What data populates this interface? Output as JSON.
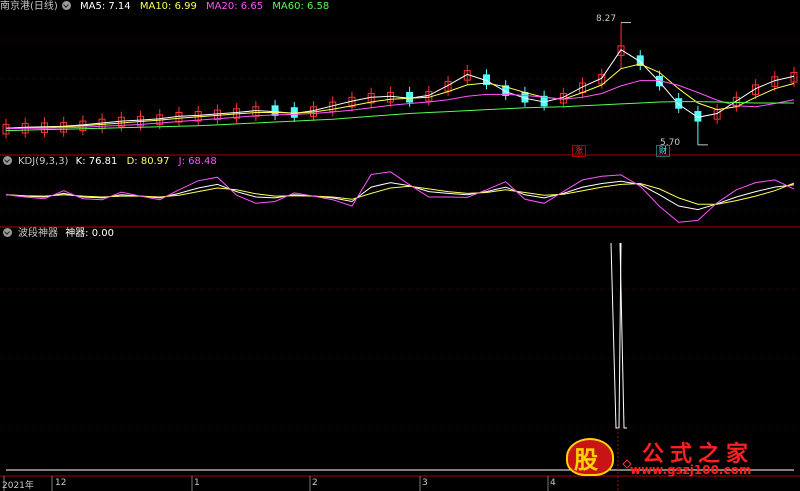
{
  "header": {
    "stock_name": "南京港(日线)",
    "ma5": "MA5: 7.14",
    "ma10": "MA10: 6.99",
    "ma20": "MA20: 6.65",
    "ma60": "MA60: 6.58"
  },
  "kdj_header": {
    "name": "KDJ(9,3,3)",
    "k": "K: 76.81",
    "d": "D: 80.97",
    "j": "J: 68.48"
  },
  "indicator_header": {
    "name": "波段神器",
    "value": "神器: 0.00"
  },
  "price_annotations": {
    "high": "8.27",
    "low": "5.70",
    "up_tag": "涨",
    "low_tag": "财"
  },
  "watermark": {
    "glyph": "股",
    "brand": "公式之家",
    "url": "www.gszj100.com"
  },
  "colors": {
    "background": "#000000",
    "up": "#ff3232",
    "down": "#54ffff",
    "ma5": "#ffffff",
    "ma10": "#ffff54",
    "ma20": "#ff54ff",
    "ma60": "#54ff54",
    "kdj_k": "#ffffff",
    "kdj_d": "#ffff54",
    "kdj_j": "#ff54ff",
    "separator": "#aa0000",
    "grid": "#3a0000"
  },
  "x_axis": {
    "labels": [
      "2021年",
      "12",
      "1",
      "2",
      "3",
      "4"
    ]
  },
  "chart_data": [
    {
      "type": "candlestick",
      "title": "南京港(日线)",
      "series": [
        {
          "name": "MA5",
          "values": [
            6.05,
            6.07,
            6.08,
            6.09,
            6.12,
            6.16,
            6.2,
            6.22,
            6.25,
            6.3,
            6.32,
            6.35,
            6.38,
            6.42,
            6.4,
            6.36,
            6.42,
            6.52,
            6.62,
            6.7,
            6.72,
            6.68,
            6.74,
            6.95,
            7.18,
            7.05,
            6.82,
            6.68,
            6.6,
            6.7,
            6.92,
            7.1,
            7.7,
            7.45,
            7.02,
            6.55,
            6.28,
            6.36,
            6.62,
            6.88,
            7.05,
            7.14
          ]
        },
        {
          "name": "MA10",
          "values": [
            6.05,
            6.06,
            6.07,
            6.08,
            6.1,
            6.13,
            6.16,
            6.19,
            6.22,
            6.26,
            6.29,
            6.32,
            6.35,
            6.38,
            6.38,
            6.37,
            6.39,
            6.45,
            6.52,
            6.6,
            6.66,
            6.68,
            6.7,
            6.82,
            6.96,
            7.0,
            6.92,
            6.8,
            6.7,
            6.66,
            6.8,
            6.96,
            7.3,
            7.4,
            7.22,
            6.88,
            6.58,
            6.44,
            6.5,
            6.7,
            6.88,
            6.99
          ]
        },
        {
          "name": "MA20",
          "values": [
            6.04,
            6.05,
            6.05,
            6.06,
            6.07,
            6.09,
            6.11,
            6.13,
            6.16,
            6.19,
            6.22,
            6.25,
            6.28,
            6.31,
            6.33,
            6.34,
            6.36,
            6.39,
            6.43,
            6.48,
            6.53,
            6.57,
            6.6,
            6.65,
            6.72,
            6.76,
            6.76,
            6.74,
            6.7,
            6.66,
            6.7,
            6.78,
            6.94,
            7.05,
            7.05,
            6.95,
            6.8,
            6.64,
            6.52,
            6.5,
            6.57,
            6.65
          ]
        },
        {
          "name": "MA60",
          "values": [
            6.0,
            6.01,
            6.02,
            6.03,
            6.04,
            6.05,
            6.06,
            6.07,
            6.08,
            6.09,
            6.1,
            6.12,
            6.14,
            6.16,
            6.18,
            6.2,
            6.22,
            6.24,
            6.27,
            6.3,
            6.33,
            6.36,
            6.38,
            6.4,
            6.42,
            6.44,
            6.46,
            6.48,
            6.49,
            6.5,
            6.52,
            6.54,
            6.56,
            6.58,
            6.6,
            6.61,
            6.61,
            6.6,
            6.59,
            6.58,
            6.58,
            6.58
          ]
        }
      ],
      "high": 8.27,
      "low": 5.7
    },
    {
      "type": "line",
      "title": "KDJ(9,3,3)",
      "series": [
        {
          "name": "K",
          "values": [
            55,
            52,
            50,
            58,
            50,
            48,
            55,
            52,
            48,
            58,
            70,
            78,
            62,
            50,
            48,
            55,
            52,
            48,
            40,
            72,
            82,
            75,
            62,
            58,
            55,
            62,
            72,
            55,
            48,
            58,
            72,
            80,
            85,
            78,
            55,
            30,
            22,
            35,
            50,
            62,
            72,
            77
          ]
        },
        {
          "name": "D",
          "values": [
            55,
            53,
            52,
            55,
            52,
            50,
            52,
            52,
            50,
            54,
            62,
            70,
            66,
            57,
            52,
            53,
            52,
            50,
            45,
            58,
            70,
            74,
            68,
            62,
            58,
            60,
            66,
            60,
            54,
            56,
            64,
            72,
            78,
            80,
            68,
            48,
            34,
            34,
            42,
            52,
            64,
            81
          ]
        },
        {
          "name": "J",
          "values": [
            55,
            50,
            46,
            64,
            46,
            44,
            61,
            52,
            44,
            66,
            86,
            94,
            54,
            36,
            40,
            59,
            52,
            44,
            30,
            100,
            106,
            77,
            50,
            50,
            49,
            66,
            84,
            45,
            36,
            62,
            88,
            96,
            99,
            74,
            29,
            -6,
            -2,
            37,
            66,
            82,
            88,
            68
          ]
        }
      ]
    },
    {
      "type": "line",
      "title": "波段神器",
      "series": [
        {
          "name": "神器",
          "values": [
            0,
            0,
            0,
            0,
            0,
            0,
            0,
            0,
            0,
            0,
            0,
            0,
            0,
            0,
            0,
            0,
            0,
            0,
            0,
            0,
            0,
            0,
            0,
            0,
            0,
            0,
            0,
            0,
            0,
            0,
            0,
            0,
            0,
            0,
            0,
            0,
            0,
            0,
            0,
            0,
            0,
            0
          ]
        }
      ]
    }
  ]
}
